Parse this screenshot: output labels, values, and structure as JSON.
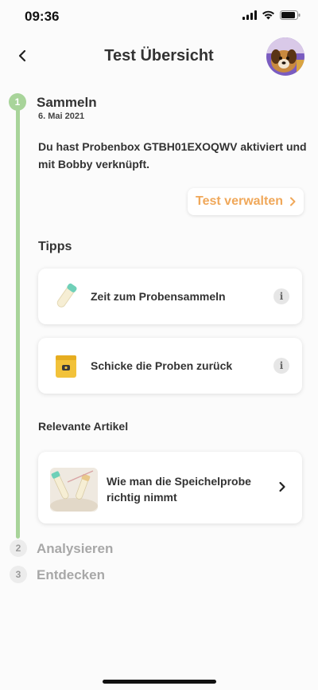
{
  "status_bar": {
    "time": "09:36"
  },
  "header": {
    "title": "Test Übersicht"
  },
  "steps": [
    {
      "number": "1",
      "title": "Sammeln",
      "date": "6. Mai 2021"
    },
    {
      "number": "2",
      "title": "Analysieren"
    },
    {
      "number": "3",
      "title": "Entdecken"
    }
  ],
  "collect": {
    "description": "Du hast Probenbox GTBH01EXOQWV aktiviert und mit Bobby  verknüpft.",
    "manage_label": "Test verwalten"
  },
  "tips": {
    "title": "Tipps",
    "items": [
      {
        "label": "Zeit zum Probensammeln",
        "icon": "sample-tube-icon"
      },
      {
        "label": "Schicke die Proben zurück",
        "icon": "return-box-icon"
      }
    ],
    "info_glyph": "i"
  },
  "articles": {
    "title": "Relevante Artikel",
    "items": [
      {
        "title": "Wie man die Speichelprobe richtig nimmt"
      }
    ]
  },
  "colors": {
    "progress_green": "#a8d49a",
    "accent_orange": "#f0a85a"
  }
}
